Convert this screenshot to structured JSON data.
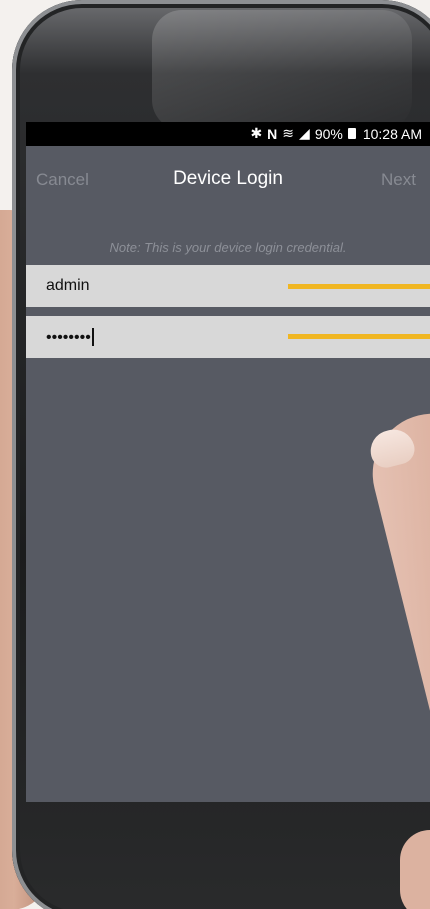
{
  "status_bar": {
    "icons": [
      "bluetooth-icon",
      "nfc-icon",
      "wifi-icon",
      "signal-icon",
      "battery-icon"
    ],
    "battery": "90%",
    "time": "10:28 AM"
  },
  "nav": {
    "cancel_label": "Cancel",
    "title": "Device Login",
    "next_label": "Next"
  },
  "note": "Note: This is your device login credential.",
  "fields": {
    "username_value": "admin",
    "password_value": "••••••••"
  },
  "colors": {
    "screen_bg": "#575a63",
    "field_bg": "#d8d8d8",
    "callout": "#f0b622",
    "status_bar_bg": "#000000"
  }
}
